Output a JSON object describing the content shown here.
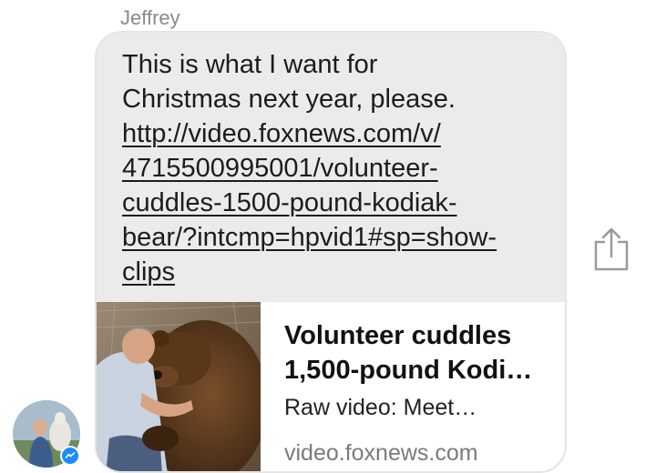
{
  "message": {
    "sender_name": "Jeffrey",
    "text_lines": [
      "This is what I want for",
      "Christmas next year, please."
    ],
    "link_lines": [
      "http://video.foxnews.com/v/",
      "4715500995001/volunteer-",
      "cuddles-1500-pound-kodiak-",
      "bear/?intcmp=hpvid1#sp=show-",
      "clips"
    ]
  },
  "link_preview": {
    "title_lines": [
      "Volunteer cuddles",
      "1,500-pound Kodi…"
    ],
    "description": "Raw video: Meet…",
    "domain": "video.foxnews.com",
    "thumbnail_icon": "man-hugging-bear-photo"
  },
  "actions": {
    "share_icon": "share-icon"
  },
  "avatar": {
    "icon": "sender-avatar",
    "badge_icon": "messenger-badge-icon"
  },
  "colors": {
    "bubble_bg": "#ebebeb",
    "bubble_border": "#e4e4e4",
    "text": "#1c1c1c",
    "muted": "#8a8a8a",
    "messenger_blue": "#1a8cff"
  }
}
